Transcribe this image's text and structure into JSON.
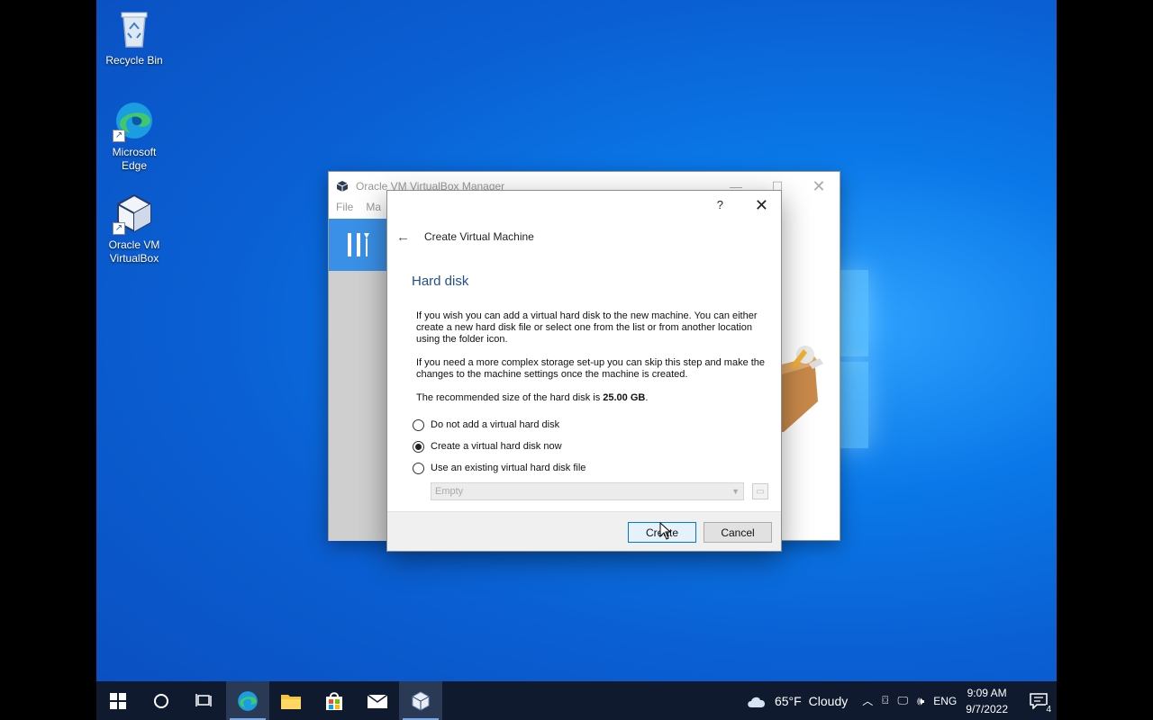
{
  "desktop": {
    "icons": [
      {
        "label": "Recycle Bin",
        "icon": "recycle-bin-icon"
      },
      {
        "label": "Microsoft Edge",
        "label_lines": [
          "Microsoft",
          "Edge"
        ],
        "icon": "edge-icon"
      },
      {
        "label": "Oracle VM VirtualBox",
        "label_lines": [
          "Oracle VM",
          "VirtualBox"
        ],
        "icon": "virtualbox-icon"
      }
    ]
  },
  "vbox_manager": {
    "title": "Oracle VM VirtualBox Manager",
    "menu": [
      "File",
      "Ma"
    ]
  },
  "dialog": {
    "help_label": "?",
    "close_label": "✕",
    "nav_title": "Create Virtual Machine",
    "page_title": "Hard disk",
    "paragraph1": "If you wish you can add a virtual hard disk to the new machine. You can either create a new hard disk file or select one from the list or from another location using the folder icon.",
    "paragraph2": "If you need a more complex storage set-up you can skip this step and make the changes to the machine settings once the machine is created.",
    "recommended_prefix": "The recommended size of the hard disk is ",
    "recommended_size": "25.00 GB",
    "recommended_suffix": ".",
    "options": [
      {
        "label": "Do not add a virtual hard disk",
        "selected": false
      },
      {
        "label": "Create a virtual hard disk now",
        "selected": true
      },
      {
        "label": "Use an existing virtual hard disk file",
        "selected": false
      }
    ],
    "disk_select_value": "Empty",
    "create_label": "Create",
    "cancel_label": "Cancel"
  },
  "taskbar": {
    "weather_temp": "65°F",
    "weather_text": "Cloudy",
    "language": "ENG",
    "time": "9:09 AM",
    "date": "9/7/2022",
    "notification_count": "4"
  },
  "colors": {
    "accent": "#0078d7",
    "dialog_title": "#1f4e9c",
    "taskbar": "#0f1a2e"
  }
}
